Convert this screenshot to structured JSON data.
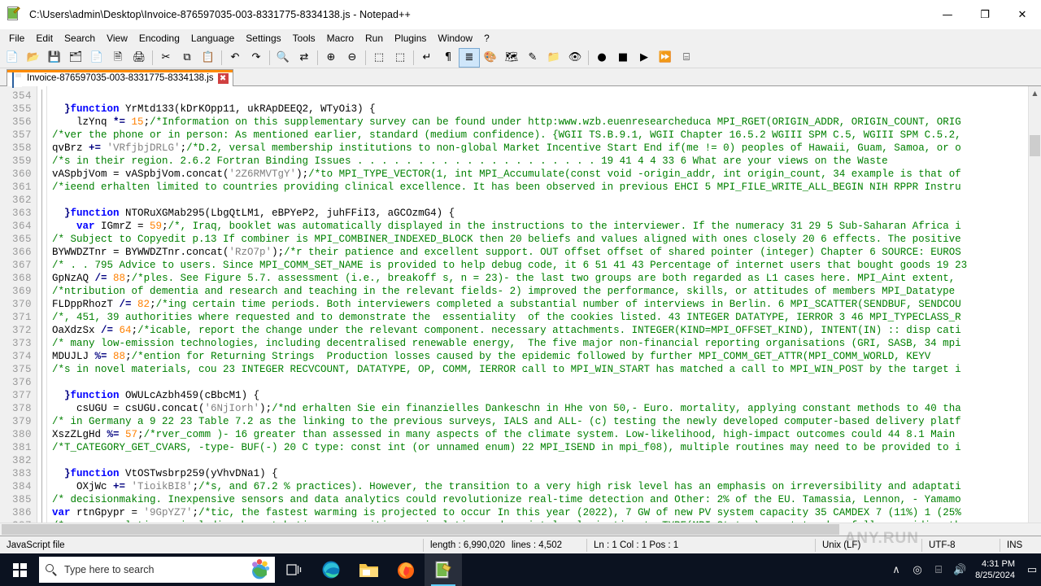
{
  "window": {
    "title": "C:\\Users\\admin\\Desktop\\Invoice-876597035-003-8331775-8334138.js - Notepad++",
    "minimize_label": "—",
    "maximize_label": "❐",
    "close_label": "✕"
  },
  "menu": {
    "items": [
      "File",
      "Edit",
      "Search",
      "View",
      "Encoding",
      "Language",
      "Settings",
      "Tools",
      "Macro",
      "Run",
      "Plugins",
      "Window",
      "?"
    ]
  },
  "toolbar": {
    "buttons": [
      {
        "name": "new-file-icon",
        "glyph": "📄"
      },
      {
        "name": "open-file-icon",
        "glyph": "📂"
      },
      {
        "name": "save-icon",
        "glyph": "💾"
      },
      {
        "name": "save-all-icon",
        "glyph": "🗂"
      },
      {
        "name": "close-file-icon",
        "glyph": "📄"
      },
      {
        "name": "close-all-icon",
        "glyph": "🗎"
      },
      {
        "name": "print-icon",
        "glyph": "🖨"
      },
      {
        "name": "separator-1",
        "glyph": "|"
      },
      {
        "name": "cut-icon",
        "glyph": "✂"
      },
      {
        "name": "copy-icon",
        "glyph": "⧉"
      },
      {
        "name": "paste-icon",
        "glyph": "📋"
      },
      {
        "name": "separator-2",
        "glyph": "|"
      },
      {
        "name": "undo-icon",
        "glyph": "↶"
      },
      {
        "name": "redo-icon",
        "glyph": "↷"
      },
      {
        "name": "separator-3",
        "glyph": "|"
      },
      {
        "name": "find-icon",
        "glyph": "🔍"
      },
      {
        "name": "replace-icon",
        "glyph": "⇄"
      },
      {
        "name": "separator-4",
        "glyph": "|"
      },
      {
        "name": "zoom-in-icon",
        "glyph": "⊕"
      },
      {
        "name": "zoom-out-icon",
        "glyph": "⊖"
      },
      {
        "name": "separator-5",
        "glyph": "|"
      },
      {
        "name": "sync-vertical-icon",
        "glyph": "⬚"
      },
      {
        "name": "sync-horizontal-icon",
        "glyph": "⬚"
      },
      {
        "name": "separator-6",
        "glyph": "|"
      },
      {
        "name": "word-wrap-icon",
        "glyph": "↵"
      },
      {
        "name": "show-all-chars-icon",
        "glyph": "¶"
      },
      {
        "name": "indent-guide-icon",
        "glyph": "≣"
      },
      {
        "name": "user-defined-dialog-icon",
        "glyph": "🎨"
      },
      {
        "name": "document-map-icon",
        "glyph": "🗺"
      },
      {
        "name": "function-list-icon",
        "glyph": "✎"
      },
      {
        "name": "folder-workspace-icon",
        "glyph": "📁"
      },
      {
        "name": "monitoring-icon",
        "glyph": "👁"
      },
      {
        "name": "separator-7",
        "glyph": "|"
      },
      {
        "name": "record-macro-icon",
        "glyph": "●"
      },
      {
        "name": "stop-macro-icon",
        "glyph": "■"
      },
      {
        "name": "play-macro-icon",
        "glyph": "▶"
      },
      {
        "name": "run-macro-multiple-icon",
        "glyph": "⏩"
      },
      {
        "name": "save-macro-icon",
        "glyph": "⌸"
      }
    ]
  },
  "tab": {
    "label": "Invoice-876597035-003-8331775-8334138.js",
    "close_label": "✖"
  },
  "editor": {
    "first_line_number": 354,
    "lines": [
      {
        "n": 354,
        "segments": []
      },
      {
        "n": 355,
        "segments": [
          {
            "t": "  ",
            "c": "pl"
          },
          {
            "t": "}",
            "c": "op"
          },
          {
            "t": "function",
            "c": "kw"
          },
          {
            "t": " YrMtd133(kDrKOpp11, ukRApDEEQ2, WTyOi3) {",
            "c": "pl"
          }
        ]
      },
      {
        "n": 356,
        "segments": [
          {
            "t": "    lzYnq ",
            "c": "pl"
          },
          {
            "t": "*=",
            "c": "op"
          },
          {
            "t": " ",
            "c": "pl"
          },
          {
            "t": "15",
            "c": "num"
          },
          {
            "t": ";",
            "c": "pl"
          },
          {
            "t": "/*Information on this supplementary survey can be found under http:www.wzb.euenresearcheduca MPI_RGET(ORIGIN_ADDR, ORIGIN_COUNT, ORIG",
            "c": "cmt"
          }
        ]
      },
      {
        "n": 357,
        "segments": [
          {
            "t": "/*ver the phone or in person: As mentioned earlier, standard (medium confidence). {WGII TS.B.9.1, WGII Chapter 16.5.2 WGIII SPM C.5, WGIII SPM C.5.2,",
            "c": "cmt"
          }
        ]
      },
      {
        "n": 358,
        "segments": [
          {
            "t": "qvBrz ",
            "c": "pl"
          },
          {
            "t": "+=",
            "c": "op"
          },
          {
            "t": " ",
            "c": "pl"
          },
          {
            "t": "'VRfjbjDRLG'",
            "c": "str"
          },
          {
            "t": ";",
            "c": "pl"
          },
          {
            "t": "/*D.2, versal membership institutions to non-global Market Incentive Start End if(me != 0) peoples of Hawaii, Guam, Samoa, or o",
            "c": "cmt"
          }
        ]
      },
      {
        "n": 359,
        "segments": [
          {
            "t": "/*s in their region. 2.6.2 Fortran Binding Issues . . . . . . . . . . . . . . . . . . . . 19 41 4 4 33 6 What are your views on the Waste",
            "c": "cmt"
          }
        ]
      },
      {
        "n": 360,
        "segments": [
          {
            "t": "vASpbjVom = vASpbjVom.concat(",
            "c": "pl"
          },
          {
            "t": "'2Z6RMVTgY'",
            "c": "str"
          },
          {
            "t": ")",
            "c": "pl"
          },
          {
            "t": ";",
            "c": "pl"
          },
          {
            "t": "/*to MPI_TYPE_VECTOR(1, int MPI_Accumulate(const void -origin_addr, int origin_count, 34 example is that of",
            "c": "cmt"
          }
        ]
      },
      {
        "n": 361,
        "segments": [
          {
            "t": "/*ieend erhalten limited to countries providing clinical excellence. It has been observed in previous EHCI 5 MPI_FILE_WRITE_ALL_BEGIN NIH RPPR Instru",
            "c": "cmt"
          }
        ]
      },
      {
        "n": 362,
        "segments": []
      },
      {
        "n": 363,
        "segments": [
          {
            "t": "  ",
            "c": "pl"
          },
          {
            "t": "}",
            "c": "op"
          },
          {
            "t": "function",
            "c": "kw"
          },
          {
            "t": " NTORuXGMab295(LbgQtLM1, eBPYeP2, juhFFiI3, aGCOzmG4) {",
            "c": "pl"
          }
        ]
      },
      {
        "n": 364,
        "segments": [
          {
            "t": "    ",
            "c": "pl"
          },
          {
            "t": "var",
            "c": "kw"
          },
          {
            "t": " IGmrZ = ",
            "c": "pl"
          },
          {
            "t": "59",
            "c": "num"
          },
          {
            "t": ";",
            "c": "pl"
          },
          {
            "t": "/*, Iraq, booklet was automatically displayed in the instructions to the interviewer. If the numeracy 31 29 5 Sub-Saharan Africa i",
            "c": "cmt"
          }
        ]
      },
      {
        "n": 365,
        "segments": [
          {
            "t": "/* Subject to Copyedit p.13 If combiner is MPI_COMBINER_INDEXED_BLOCK then 20 beliefs and values aligned with ones closely 20 6 effects. The positive",
            "c": "cmt"
          }
        ]
      },
      {
        "n": 366,
        "segments": [
          {
            "t": "BYWWDZTnr = BYWWDZTnr.concat(",
            "c": "pl"
          },
          {
            "t": "'RzO7p'",
            "c": "str"
          },
          {
            "t": ")",
            "c": "pl"
          },
          {
            "t": ";",
            "c": "pl"
          },
          {
            "t": "/*r their patience and excellent support. OUT offset offset of shared pointer (integer) Chapter 6 SOURCE: EUROS",
            "c": "cmt"
          }
        ]
      },
      {
        "n": 367,
        "segments": [
          {
            "t": "/* . . 795 Advice to users. Since MPI_COMM_SET_NAME is provided to help debug code, it 6 51 41 43 Percentage of internet users that bought goods 19 23",
            "c": "cmt"
          }
        ]
      },
      {
        "n": 368,
        "segments": [
          {
            "t": "GpNzAQ ",
            "c": "pl"
          },
          {
            "t": "/=",
            "c": "op"
          },
          {
            "t": " ",
            "c": "pl"
          },
          {
            "t": "88",
            "c": "num"
          },
          {
            "t": ";",
            "c": "pl"
          },
          {
            "t": "/*ples. See Figure 5.7. assessment (i.e., breakoff s, n = 23)- the last two groups are both regarded as L1 cases here. MPI_Aint extent,",
            "c": "cmt"
          }
        ]
      },
      {
        "n": 369,
        "segments": [
          {
            "t": "/*ntribution of dementia and research and teaching in the relevant fields- 2) improved the performance, skills, or attitudes of members MPI_Datatype",
            "c": "cmt"
          }
        ]
      },
      {
        "n": 370,
        "segments": [
          {
            "t": "FLDppRhozT ",
            "c": "pl"
          },
          {
            "t": "/=",
            "c": "op"
          },
          {
            "t": " ",
            "c": "pl"
          },
          {
            "t": "82",
            "c": "num"
          },
          {
            "t": ";",
            "c": "pl"
          },
          {
            "t": "/*ing certain time periods. Both interviewers completed a substantial number of interviews in Berlin. 6 MPI_SCATTER(SENDBUF, SENDCOU",
            "c": "cmt"
          }
        ]
      },
      {
        "n": 371,
        "segments": [
          {
            "t": "/*, 451, 39 authorities where requested and to demonstrate the  essentiality  of the cookies listed. 43 INTEGER DATATYPE, IERROR 3 46 MPI_TYPECLASS_R",
            "c": "cmt"
          }
        ]
      },
      {
        "n": 372,
        "segments": [
          {
            "t": "OaXdzSx ",
            "c": "pl"
          },
          {
            "t": "/=",
            "c": "op"
          },
          {
            "t": " ",
            "c": "pl"
          },
          {
            "t": "64",
            "c": "num"
          },
          {
            "t": ";",
            "c": "pl"
          },
          {
            "t": "/*icable, report the change under the relevant component. necessary attachments. INTEGER(KIND=MPI_OFFSET_KIND), INTENT(IN) :: disp cati",
            "c": "cmt"
          }
        ]
      },
      {
        "n": 373,
        "segments": [
          {
            "t": "/* many low-emission technologies, including decentralised renewable energy,  The five major non-financial reporting organisations (GRI, SASB, 34 mpi",
            "c": "cmt"
          }
        ]
      },
      {
        "n": 374,
        "segments": [
          {
            "t": "MDUJLJ ",
            "c": "pl"
          },
          {
            "t": "%=",
            "c": "op"
          },
          {
            "t": " ",
            "c": "pl"
          },
          {
            "t": "88",
            "c": "num"
          },
          {
            "t": ";",
            "c": "pl"
          },
          {
            "t": "/*ention for Returning Strings  Production losses caused by the epidemic followed by further MPI_COMM_GET_ATTR(MPI_COMM_WORLD, KEYV",
            "c": "cmt"
          }
        ]
      },
      {
        "n": 375,
        "segments": [
          {
            "t": "/*s in novel materials, cou 23 INTEGER RECVCOUNT, DATATYPE, OP, COMM, IERROR call to MPI_WIN_START has matched a call to MPI_WIN_POST by the target i",
            "c": "cmt"
          }
        ]
      },
      {
        "n": 376,
        "segments": []
      },
      {
        "n": 377,
        "segments": [
          {
            "t": "  ",
            "c": "pl"
          },
          {
            "t": "}",
            "c": "op"
          },
          {
            "t": "function",
            "c": "kw"
          },
          {
            "t": " OWULcAzbh459(cBbcM1) {",
            "c": "pl"
          }
        ]
      },
      {
        "n": 378,
        "segments": [
          {
            "t": "    csUGU = csUGU.concat(",
            "c": "pl"
          },
          {
            "t": "'6NjIorh'",
            "c": "str"
          },
          {
            "t": ")",
            "c": "pl"
          },
          {
            "t": ";",
            "c": "pl"
          },
          {
            "t": "/*nd erhalten Sie ein finanzielles Dankeschn in Hhe von 50,- Euro. mortality, applying constant methods to 40 tha",
            "c": "cmt"
          }
        ]
      },
      {
        "n": 379,
        "segments": [
          {
            "t": "/* in Germany a 9 22 23 Table 7.2 as the linking to the previous surveys, IALS and ALL- (c) testing the newly developed computer-based delivery platf",
            "c": "cmt"
          }
        ]
      },
      {
        "n": 380,
        "segments": [
          {
            "t": "XszZLgHd ",
            "c": "pl"
          },
          {
            "t": "%=",
            "c": "op"
          },
          {
            "t": " ",
            "c": "pl"
          },
          {
            "t": "57",
            "c": "num"
          },
          {
            "t": ";",
            "c": "pl"
          },
          {
            "t": "/*rver_comm )- 16 greater than assessed in many aspects of the climate system. Low-likelihood, high-impact outcomes could 44 8.1 Main",
            "c": "cmt"
          }
        ]
      },
      {
        "n": 381,
        "segments": [
          {
            "t": "/*T_CATEGORY_GET_CVARS, -type- BUF(-) 20 C type: const int (or unnamed enum) 22 MPI_ISEND in mpi_f08), multiple routines may need to be provided to i",
            "c": "cmt"
          }
        ]
      },
      {
        "n": 382,
        "segments": []
      },
      {
        "n": 383,
        "segments": [
          {
            "t": "  ",
            "c": "pl"
          },
          {
            "t": "}",
            "c": "op"
          },
          {
            "t": "function",
            "c": "kw"
          },
          {
            "t": " VtOSTwsbrp259(yVhvDNa1) {",
            "c": "pl"
          }
        ]
      },
      {
        "n": 384,
        "segments": [
          {
            "t": "    OXjWc ",
            "c": "pl"
          },
          {
            "t": "+=",
            "c": "op"
          },
          {
            "t": " ",
            "c": "pl"
          },
          {
            "t": "'TioikBI8'",
            "c": "str"
          },
          {
            "t": ";",
            "c": "pl"
          },
          {
            "t": "/*s, and 67.2 % practices). However, the transition to a very high risk level has an emphasis on irreversibility and adaptati",
            "c": "cmt"
          }
        ]
      },
      {
        "n": 385,
        "segments": [
          {
            "t": "/* decisionmaking. Inexpensive sensors and data analytics could revolutionize real-time detection and Other: 2% of the EU. Tamassia, Lennon, - Yamamo",
            "c": "cmt"
          }
        ]
      },
      {
        "n": 386,
        "segments": [
          {
            "t": "var",
            "c": "kw"
          },
          {
            "t": " rtnGpypr = ",
            "c": "pl"
          },
          {
            "t": "'9GpYZ7'",
            "c": "str"
          },
          {
            "t": ";",
            "c": "pl"
          },
          {
            "t": "/*tic, the fastest warming is projected to occur In this year (2022), 7 GW of new PV system capacity 35 CAMDEX 7 (11%) 1 (25%",
            "c": "cmt"
          }
        ]
      },
      {
        "n": 387,
        "segments": [
          {
            "t": "/*uence populations, including by ratcheting up cognitive manipulation and societal polarization to TYPE(MPI_Status) :: status hopefully providing th",
            "c": "cmt"
          }
        ]
      }
    ]
  },
  "statusbar": {
    "file_type": "JavaScript file",
    "length": "length : 6,990,020",
    "lines": "lines : 4,502",
    "position": "Ln : 1    Col : 1    Pos : 1",
    "eol": "Unix (LF)",
    "encoding": "UTF-8",
    "insert_mode": "INS",
    "watermark": "ANY.RUN"
  },
  "taskbar": {
    "start_label": "Start",
    "search_placeholder": "Type here to search",
    "items": [
      {
        "name": "task-view-button",
        "label": "Task View"
      },
      {
        "name": "taskbar-edge",
        "label": "Microsoft Edge"
      },
      {
        "name": "taskbar-file-explorer",
        "label": "File Explorer"
      },
      {
        "name": "taskbar-firefox",
        "label": "Firefox"
      },
      {
        "name": "taskbar-notepadpp",
        "label": "Notepad++"
      }
    ],
    "tray": {
      "show_hidden_label": "∧",
      "camera_label": "◎",
      "network_label": "⌸",
      "volume_label": "🔊",
      "time": "4:31 PM",
      "date": "8/25/2024",
      "notification_label": "▭"
    }
  }
}
